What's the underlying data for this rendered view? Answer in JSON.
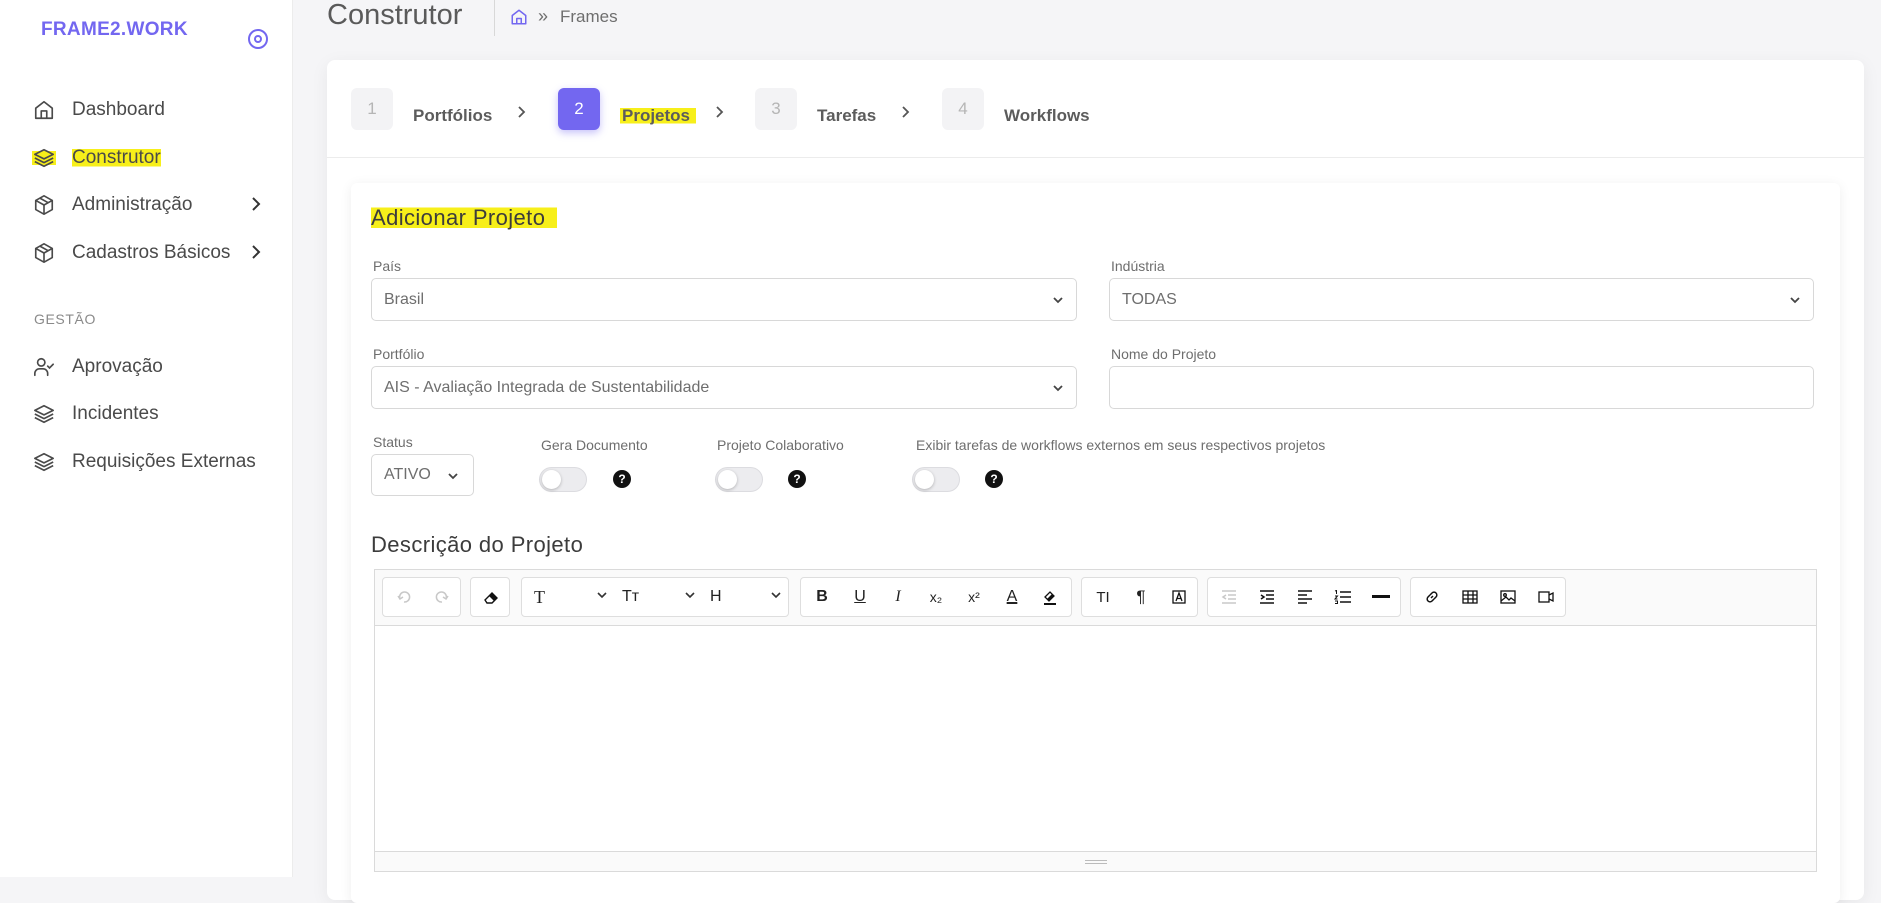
{
  "brand": "FRAME2.WORK",
  "sidebar": {
    "items": [
      {
        "label": "Dashboard",
        "icon": "home-icon"
      },
      {
        "label": "Construtor",
        "icon": "layers-icon"
      },
      {
        "label": "Administração",
        "icon": "box-icon"
      },
      {
        "label": "Cadastros Básicos",
        "icon": "box-icon"
      }
    ],
    "section": "GESTÃO",
    "gestao_items": [
      {
        "label": "Aprovação",
        "icon": "user-check-icon"
      },
      {
        "label": "Incidentes",
        "icon": "layers-icon"
      },
      {
        "label": "Requisições Externas",
        "icon": "layers-icon"
      }
    ]
  },
  "header": {
    "title": "Construtor",
    "breadcrumb": "Frames"
  },
  "steps": [
    {
      "number": "1",
      "label": "Portfólios"
    },
    {
      "number": "2",
      "label": "Projetos"
    },
    {
      "number": "3",
      "label": "Tarefas"
    },
    {
      "number": "4",
      "label": "Workflows"
    }
  ],
  "form": {
    "title": "Adicionar Projeto",
    "pais": {
      "label": "País",
      "value": "Brasil"
    },
    "industria": {
      "label": "Indústria",
      "value": "TODAS"
    },
    "portfolio": {
      "label": "Portfólio",
      "value": "AIS - Avaliação Integrada de Sustentabilidade"
    },
    "nome": {
      "label": "Nome do Projeto",
      "value": ""
    },
    "status": {
      "label": "Status",
      "value": "ATIVO"
    },
    "gera_documento": {
      "label": "Gera Documento"
    },
    "projeto_colaborativo": {
      "label": "Projeto Colaborativo"
    },
    "exibir_tarefas": {
      "label": "Exibir tarefas de workflows externos em seus respectivos projetos"
    },
    "help_glyph": "?",
    "descricao_title": "Descrição do Projeto"
  },
  "toolbar": {
    "font_glyph": "T",
    "size_glyph": "Tт",
    "heading_glyph": "H",
    "bold": "B",
    "underline": "U",
    "italic": "I",
    "subscript": "x₂",
    "superscript": "x²",
    "font_color": "A",
    "text_style": "TI",
    "paragraph": "¶"
  },
  "colors": {
    "accent": "#7367f0",
    "highlight": "#f7ef1a"
  }
}
